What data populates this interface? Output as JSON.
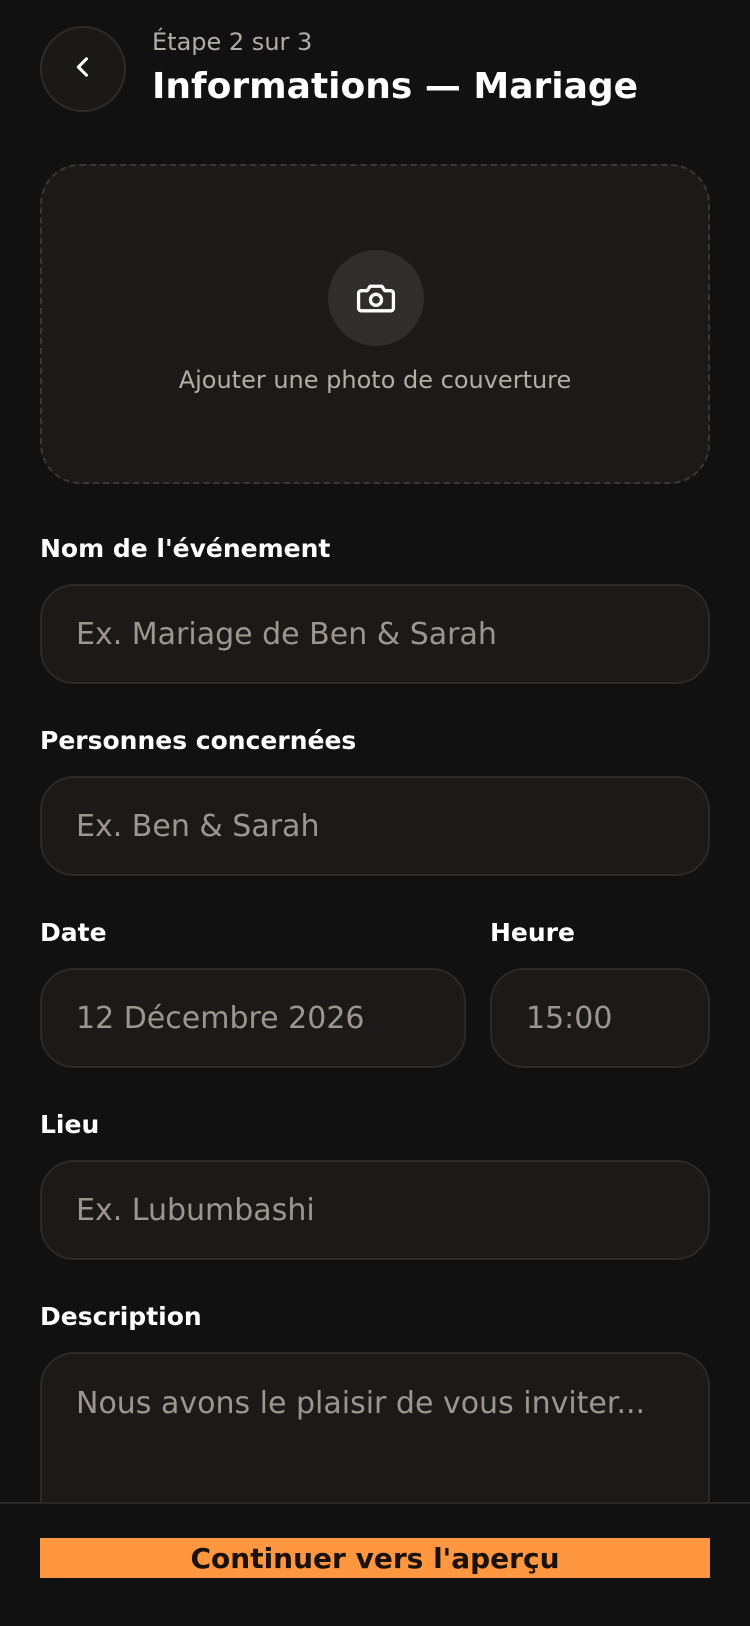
{
  "header": {
    "step": "Étape 2 sur 3",
    "title": "Informations — Mariage"
  },
  "cover": {
    "label": "Ajouter une photo de couverture",
    "icon": "camera-icon"
  },
  "form": {
    "event_name": {
      "label": "Nom de l'événement",
      "placeholder": "Ex. Mariage de Ben & Sarah"
    },
    "people": {
      "label": "Personnes concernées",
      "placeholder": "Ex. Ben & Sarah"
    },
    "date": {
      "label": "Date",
      "value": "12 Décembre 2026"
    },
    "time": {
      "label": "Heure",
      "value": "15:00"
    },
    "place": {
      "label": "Lieu",
      "placeholder": "Ex. Lubumbashi"
    },
    "description": {
      "label": "Description",
      "placeholder": "Nous avons le plaisir de vous inviter..."
    }
  },
  "footer": {
    "continue_label": "Continuer vers l'aperçu"
  },
  "colors": {
    "background": "#111111",
    "field_background": "#1b1a19",
    "accent": "#ff9640"
  }
}
